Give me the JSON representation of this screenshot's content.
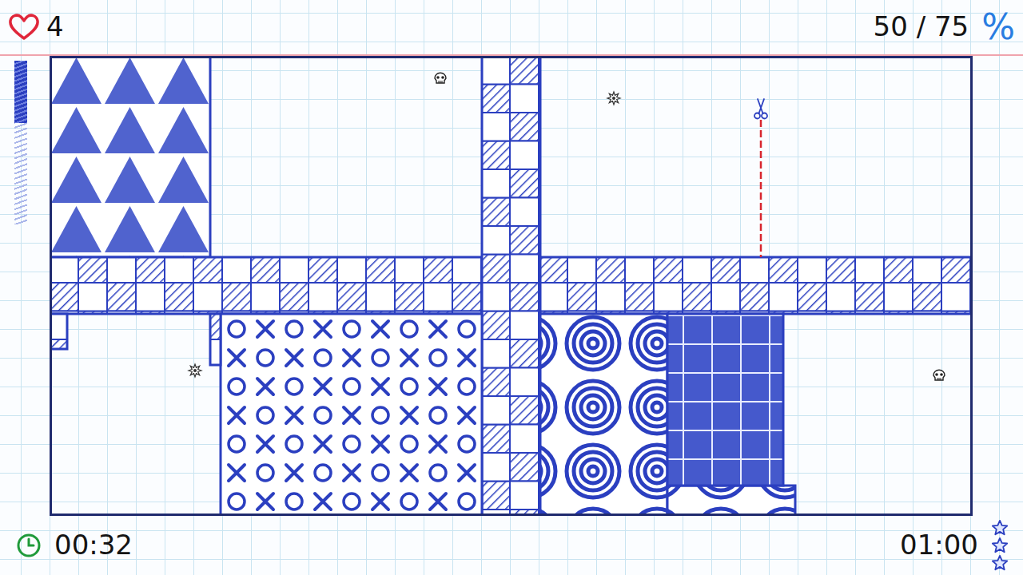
{
  "hud": {
    "lives": "4",
    "progress": "50 / 75",
    "percent_icon": "%",
    "elapsed": "00:32",
    "target": "01:00",
    "stars": 0,
    "ink_level": 0.38
  },
  "board": {
    "regions": [
      {
        "kind": "triangles"
      },
      {
        "kind": "checker"
      },
      {
        "kind": "checker"
      },
      {
        "kind": "xo"
      },
      {
        "kind": "checker"
      },
      {
        "kind": "checker"
      },
      {
        "kind": "spiral"
      },
      {
        "kind": "spiral"
      },
      {
        "kind": "grid"
      }
    ],
    "enemies": [
      {
        "kind": "skull"
      },
      {
        "kind": "spiky"
      },
      {
        "kind": "spiky"
      },
      {
        "kind": "skull"
      }
    ],
    "cutter": {
      "kind": "scissors",
      "cutting": true
    }
  }
}
